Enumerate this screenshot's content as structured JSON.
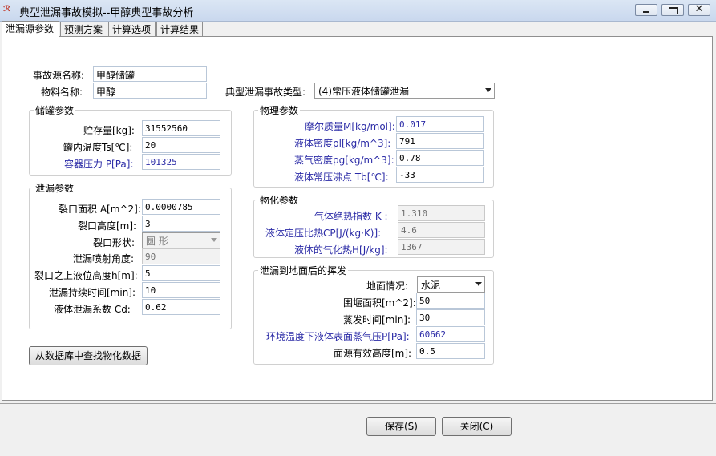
{
  "window": {
    "title": "典型泄漏事故模拟--甲醇典型事故分析",
    "app_icon": "app-logo-icon"
  },
  "tabs": [
    "泄漏源参数",
    "预测方案",
    "计算选项",
    "计算结果"
  ],
  "source": {
    "name_label": "事故源名称:",
    "name_value": "甲醇储罐",
    "material_label": "物料名称:",
    "material_value": "甲醇",
    "accident_type_label": "典型泄漏事故类型:",
    "accident_type_value": "(4)常压液体储罐泄漏"
  },
  "tank": {
    "title": "储罐参数",
    "storage_label": "贮存量[kg]:",
    "storage_value": "31552560",
    "temp_label": "罐内温度Ts[℃]:",
    "temp_value": "20",
    "pressure_label": "容器压力 P[Pa]:",
    "pressure_value": "101325"
  },
  "leak": {
    "title": "泄漏参数",
    "area_label": "裂口面积 A[m^2]:",
    "area_value": "0.0000785",
    "height_label": "裂口高度[m]:",
    "height_value": "3",
    "shape_label": "裂口形状:",
    "shape_value": "圆 形",
    "angle_label": "泄漏喷射角度:",
    "angle_value": "90",
    "level_label": "裂口之上液位高度h[m]:",
    "level_value": "5",
    "duration_label": "泄漏持续时间[min]:",
    "duration_value": "10",
    "coef_label": "液体泄漏系数  Cd:",
    "coef_value": "0.62"
  },
  "physical": {
    "title": "物理参数",
    "molar_label": "摩尔质量M[kg/mol]:",
    "molar_value": "0.017",
    "liquid_density_label": "液体密度ρl[kg/m^3]:",
    "liquid_density_value": "791",
    "vapor_density_label": "蒸气密度ρg[kg/m^3]:",
    "vapor_density_value": "0.78",
    "boiling_label": "液体常压沸点 Tb[℃]:",
    "boiling_value": "-33"
  },
  "chemical": {
    "title": "物化参数",
    "gamma_label": "气体绝热指数  K :",
    "gamma_value": "1.310",
    "cp_label": "液体定压比热CP[J/(kg·K)]:",
    "cp_value": "4.6",
    "heat_label": "液体的气化热H[J/kg]:",
    "heat_value": "1367"
  },
  "evaporation": {
    "title": "泄漏到地面后的挥发",
    "ground_label": "地面情况:",
    "ground_value": "水泥",
    "dike_label": "围堰面积[m^2]:",
    "dike_value": "50",
    "time_label": "蒸发时间[min]:",
    "time_value": "30",
    "vapor_pressure_label": "环境温度下液体表面蒸气压P[Pa]:",
    "vapor_pressure_value": "60662",
    "source_height_label": "面源有效高度[m]:",
    "source_height_value": "0.5"
  },
  "buttons": {
    "lookup": "从数据库中查找物化数据",
    "save": "保存(S)",
    "close": "关闭(C)"
  }
}
